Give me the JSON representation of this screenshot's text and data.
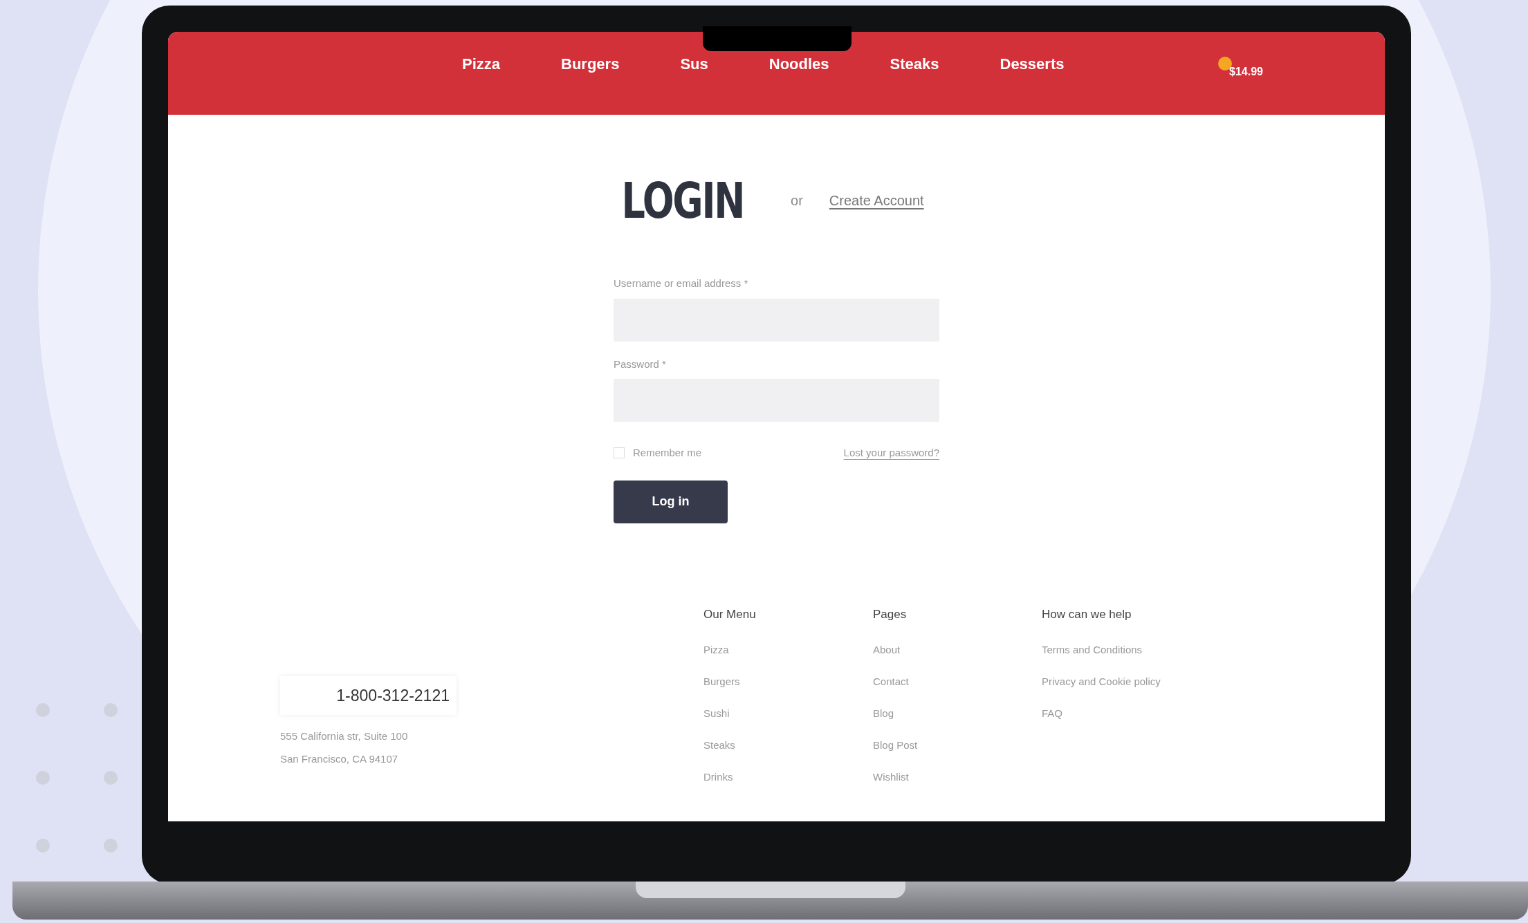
{
  "nav": {
    "items": [
      {
        "label": "Pizza"
      },
      {
        "label": "Burgers"
      },
      {
        "label": "Sus"
      },
      {
        "label": "Noodles"
      },
      {
        "label": "Steaks"
      },
      {
        "label": "Desserts"
      }
    ],
    "cart_total": "$14.99"
  },
  "login": {
    "title": "LOGIN",
    "or": "or",
    "create_account": "Create Account",
    "fields": [
      {
        "label": "Username or email address *"
      },
      {
        "label": "Password *"
      }
    ],
    "remember": {
      "label": "Remember me",
      "checked": false
    },
    "lost_password": "Lost your password?",
    "submit": "Log in"
  },
  "footer": {
    "phone": "1-800-312-2121",
    "address": [
      "555 California str, Suite 100",
      "San Francisco, CA 94107"
    ],
    "columns": [
      {
        "heading": "Our Menu",
        "links": [
          "Pizza",
          "Burgers",
          "Sushi",
          "Steaks",
          "Drinks"
        ]
      },
      {
        "heading": "Pages",
        "links": [
          "About",
          "Contact",
          "Blog",
          "Blog Post",
          "Wishlist"
        ]
      },
      {
        "heading": "How can we help",
        "links": [
          "Terms and Conditions",
          "Privacy and Cookie policy",
          "FAQ"
        ]
      }
    ]
  }
}
